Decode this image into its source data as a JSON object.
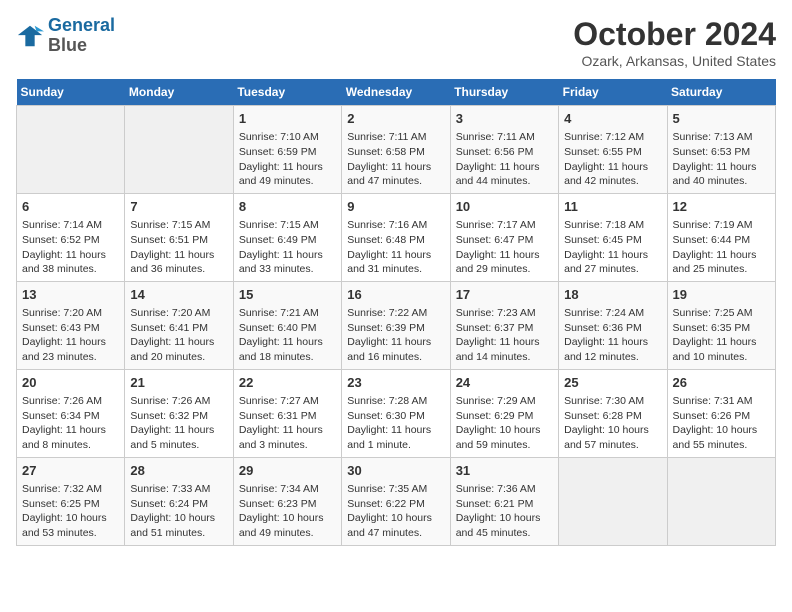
{
  "logo": {
    "line1": "General",
    "line2": "Blue"
  },
  "title": "October 2024",
  "subtitle": "Ozark, Arkansas, United States",
  "days": [
    "Sunday",
    "Monday",
    "Tuesday",
    "Wednesday",
    "Thursday",
    "Friday",
    "Saturday"
  ],
  "weeks": [
    [
      {
        "date": "",
        "sunrise": "",
        "sunset": "",
        "daylight": ""
      },
      {
        "date": "",
        "sunrise": "",
        "sunset": "",
        "daylight": ""
      },
      {
        "date": "1",
        "sunrise": "Sunrise: 7:10 AM",
        "sunset": "Sunset: 6:59 PM",
        "daylight": "Daylight: 11 hours and 49 minutes."
      },
      {
        "date": "2",
        "sunrise": "Sunrise: 7:11 AM",
        "sunset": "Sunset: 6:58 PM",
        "daylight": "Daylight: 11 hours and 47 minutes."
      },
      {
        "date": "3",
        "sunrise": "Sunrise: 7:11 AM",
        "sunset": "Sunset: 6:56 PM",
        "daylight": "Daylight: 11 hours and 44 minutes."
      },
      {
        "date": "4",
        "sunrise": "Sunrise: 7:12 AM",
        "sunset": "Sunset: 6:55 PM",
        "daylight": "Daylight: 11 hours and 42 minutes."
      },
      {
        "date": "5",
        "sunrise": "Sunrise: 7:13 AM",
        "sunset": "Sunset: 6:53 PM",
        "daylight": "Daylight: 11 hours and 40 minutes."
      }
    ],
    [
      {
        "date": "6",
        "sunrise": "Sunrise: 7:14 AM",
        "sunset": "Sunset: 6:52 PM",
        "daylight": "Daylight: 11 hours and 38 minutes."
      },
      {
        "date": "7",
        "sunrise": "Sunrise: 7:15 AM",
        "sunset": "Sunset: 6:51 PM",
        "daylight": "Daylight: 11 hours and 36 minutes."
      },
      {
        "date": "8",
        "sunrise": "Sunrise: 7:15 AM",
        "sunset": "Sunset: 6:49 PM",
        "daylight": "Daylight: 11 hours and 33 minutes."
      },
      {
        "date": "9",
        "sunrise": "Sunrise: 7:16 AM",
        "sunset": "Sunset: 6:48 PM",
        "daylight": "Daylight: 11 hours and 31 minutes."
      },
      {
        "date": "10",
        "sunrise": "Sunrise: 7:17 AM",
        "sunset": "Sunset: 6:47 PM",
        "daylight": "Daylight: 11 hours and 29 minutes."
      },
      {
        "date": "11",
        "sunrise": "Sunrise: 7:18 AM",
        "sunset": "Sunset: 6:45 PM",
        "daylight": "Daylight: 11 hours and 27 minutes."
      },
      {
        "date": "12",
        "sunrise": "Sunrise: 7:19 AM",
        "sunset": "Sunset: 6:44 PM",
        "daylight": "Daylight: 11 hours and 25 minutes."
      }
    ],
    [
      {
        "date": "13",
        "sunrise": "Sunrise: 7:20 AM",
        "sunset": "Sunset: 6:43 PM",
        "daylight": "Daylight: 11 hours and 23 minutes."
      },
      {
        "date": "14",
        "sunrise": "Sunrise: 7:20 AM",
        "sunset": "Sunset: 6:41 PM",
        "daylight": "Daylight: 11 hours and 20 minutes."
      },
      {
        "date": "15",
        "sunrise": "Sunrise: 7:21 AM",
        "sunset": "Sunset: 6:40 PM",
        "daylight": "Daylight: 11 hours and 18 minutes."
      },
      {
        "date": "16",
        "sunrise": "Sunrise: 7:22 AM",
        "sunset": "Sunset: 6:39 PM",
        "daylight": "Daylight: 11 hours and 16 minutes."
      },
      {
        "date": "17",
        "sunrise": "Sunrise: 7:23 AM",
        "sunset": "Sunset: 6:37 PM",
        "daylight": "Daylight: 11 hours and 14 minutes."
      },
      {
        "date": "18",
        "sunrise": "Sunrise: 7:24 AM",
        "sunset": "Sunset: 6:36 PM",
        "daylight": "Daylight: 11 hours and 12 minutes."
      },
      {
        "date": "19",
        "sunrise": "Sunrise: 7:25 AM",
        "sunset": "Sunset: 6:35 PM",
        "daylight": "Daylight: 11 hours and 10 minutes."
      }
    ],
    [
      {
        "date": "20",
        "sunrise": "Sunrise: 7:26 AM",
        "sunset": "Sunset: 6:34 PM",
        "daylight": "Daylight: 11 hours and 8 minutes."
      },
      {
        "date": "21",
        "sunrise": "Sunrise: 7:26 AM",
        "sunset": "Sunset: 6:32 PM",
        "daylight": "Daylight: 11 hours and 5 minutes."
      },
      {
        "date": "22",
        "sunrise": "Sunrise: 7:27 AM",
        "sunset": "Sunset: 6:31 PM",
        "daylight": "Daylight: 11 hours and 3 minutes."
      },
      {
        "date": "23",
        "sunrise": "Sunrise: 7:28 AM",
        "sunset": "Sunset: 6:30 PM",
        "daylight": "Daylight: 11 hours and 1 minute."
      },
      {
        "date": "24",
        "sunrise": "Sunrise: 7:29 AM",
        "sunset": "Sunset: 6:29 PM",
        "daylight": "Daylight: 10 hours and 59 minutes."
      },
      {
        "date": "25",
        "sunrise": "Sunrise: 7:30 AM",
        "sunset": "Sunset: 6:28 PM",
        "daylight": "Daylight: 10 hours and 57 minutes."
      },
      {
        "date": "26",
        "sunrise": "Sunrise: 7:31 AM",
        "sunset": "Sunset: 6:26 PM",
        "daylight": "Daylight: 10 hours and 55 minutes."
      }
    ],
    [
      {
        "date": "27",
        "sunrise": "Sunrise: 7:32 AM",
        "sunset": "Sunset: 6:25 PM",
        "daylight": "Daylight: 10 hours and 53 minutes."
      },
      {
        "date": "28",
        "sunrise": "Sunrise: 7:33 AM",
        "sunset": "Sunset: 6:24 PM",
        "daylight": "Daylight: 10 hours and 51 minutes."
      },
      {
        "date": "29",
        "sunrise": "Sunrise: 7:34 AM",
        "sunset": "Sunset: 6:23 PM",
        "daylight": "Daylight: 10 hours and 49 minutes."
      },
      {
        "date": "30",
        "sunrise": "Sunrise: 7:35 AM",
        "sunset": "Sunset: 6:22 PM",
        "daylight": "Daylight: 10 hours and 47 minutes."
      },
      {
        "date": "31",
        "sunrise": "Sunrise: 7:36 AM",
        "sunset": "Sunset: 6:21 PM",
        "daylight": "Daylight: 10 hours and 45 minutes."
      },
      {
        "date": "",
        "sunrise": "",
        "sunset": "",
        "daylight": ""
      },
      {
        "date": "",
        "sunrise": "",
        "sunset": "",
        "daylight": ""
      }
    ]
  ]
}
